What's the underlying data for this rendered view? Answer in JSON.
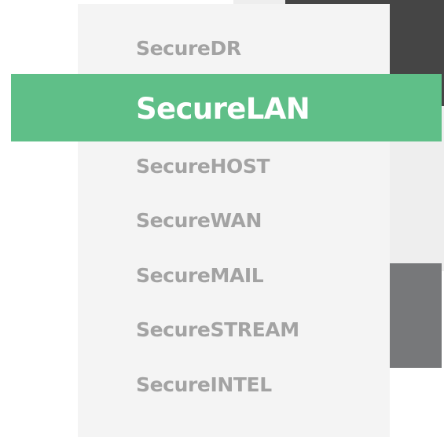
{
  "menu": {
    "items": [
      {
        "label": "SecureDR"
      },
      {
        "label": "SecureLAN"
      },
      {
        "label": "SecureHOST"
      },
      {
        "label": "SecureWAN"
      },
      {
        "label": "SecureMAIL"
      },
      {
        "label": "SecureSTREAM"
      },
      {
        "label": "SecureINTEL"
      }
    ],
    "active_index": 1
  },
  "colors": {
    "accent": "#5fbf88",
    "panel": "#f4f4f4",
    "inactive_text": "#a3a3a3",
    "active_text": "#ffffff",
    "dark_block": "#454545",
    "grey_block": "#77787a",
    "light_block": "#eeeeee"
  }
}
